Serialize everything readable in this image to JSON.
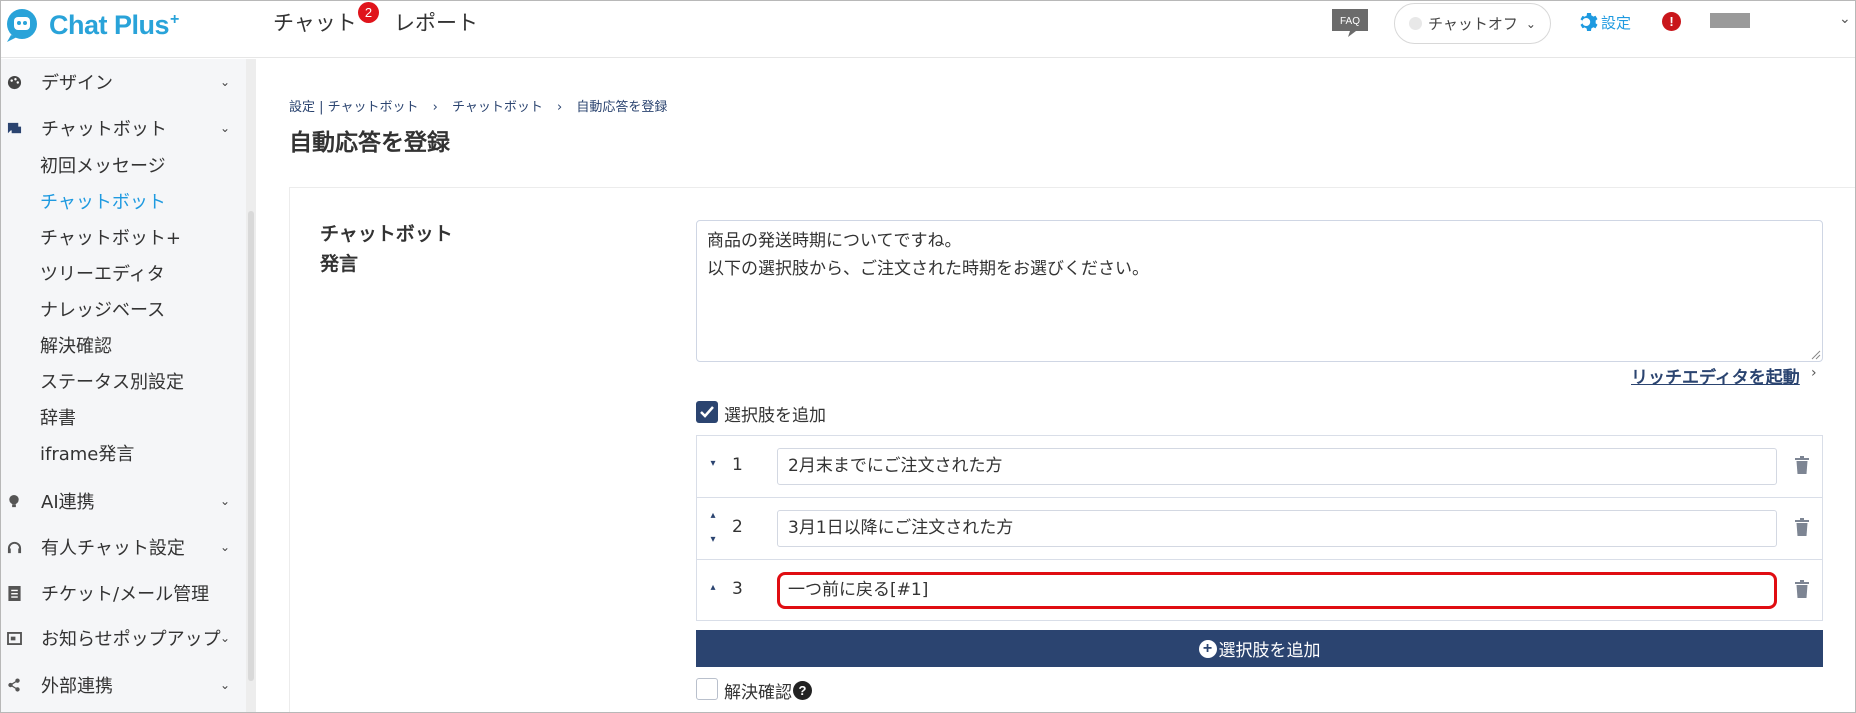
{
  "header": {
    "brand": "Chat Plus",
    "brand_sup": "+",
    "nav": [
      "チャット",
      "レポート"
    ],
    "chat_badge": "2",
    "faq_label": "FAQ",
    "chat_status": "チャットオフ",
    "settings_label": "設定",
    "alert_label": "!"
  },
  "sidebar": {
    "sections": [
      {
        "label": "デザイン",
        "icon": "palette-icon"
      },
      {
        "label": "チャットボット",
        "icon": "chat-bubble-icon"
      },
      {
        "label": "AI連携",
        "icon": "bulb-icon"
      },
      {
        "label": "有人チャット設定",
        "icon": "headset-icon"
      },
      {
        "label": "チケット/メール管理",
        "icon": "list-icon"
      },
      {
        "label": "お知らせポップアップ",
        "icon": "popup-icon"
      },
      {
        "label": "外部連携",
        "icon": "share-icon"
      }
    ],
    "submenu": [
      "初回メッセージ",
      "チャットボット",
      "チャットボット+",
      "ツリーエディタ",
      "ナレッジベース",
      "解決確認",
      "ステータス別設定",
      "辞書",
      "iframe発言"
    ],
    "active_item": "チャットボット"
  },
  "breadcrumb": [
    "設定 | チャットボット",
    "›",
    "チャットボット",
    "›",
    "自動応答を登録"
  ],
  "page_title": "自動応答を登録",
  "form": {
    "label_line1": "チャットボット",
    "label_line2": "発言",
    "message_text": "商品の発送時期についてですね。\n以下の選択肢から、ご注文された時期をお選びください。",
    "rich_editor_link": "リッチエディタを起動",
    "add_choice_checkbox": "選択肢を追加",
    "add_choice_checked": true,
    "choices": [
      {
        "num": "1",
        "text": "2月末までにご注文された方"
      },
      {
        "num": "2",
        "text": "3月1日以降にご注文された方"
      },
      {
        "num": "3",
        "text": "一つ前に戻る[#1]"
      }
    ],
    "add_choice_button": "選択肢を追加",
    "resolve_checkbox": "解決確認",
    "resolve_checked": false
  },
  "colors": {
    "accent": "#1e9ae0",
    "navy": "#2b4470",
    "badge": "#e0141b",
    "highlight": "#e00d12"
  }
}
